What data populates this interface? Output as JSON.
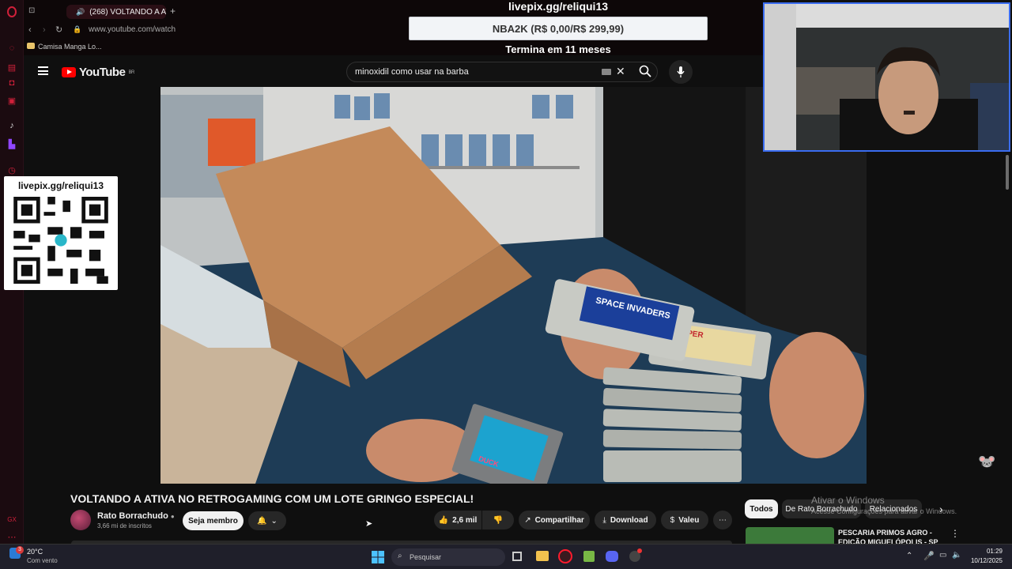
{
  "browser": {
    "tab_title": "(268) VOLTANDO A AT",
    "url": "www.youtube.com/watch",
    "bookmark": "Camisa Manga Lo...",
    "new_tab": "+"
  },
  "youtube": {
    "logo_text": "YouTube",
    "country": "BR",
    "search_value": "minoxidil como usar na barba"
  },
  "overlay": {
    "livepix_url": "livepix.gg/reliqui13",
    "goal": "NBA2K (R$ 0,00/R$ 299,99)",
    "ends_in": "Termina em 11 meses",
    "qr_url": "livepix.gg/reliqui13"
  },
  "video": {
    "title": "VOLTANDO A ATIVA NO RETROGAMING COM UM LOTE GRINGO ESPECIAL!",
    "channel": "Rato Borrachudo",
    "subscribers": "3,66 mi de inscritos",
    "join_label": "Seja membro",
    "likes": "2,6 mil",
    "share_label": "Compartilhar",
    "download_label": "Download",
    "thanks_label": "Valeu",
    "cartridge_1_text": "SPACE INVADERS",
    "cartridge_2_text": "SUPER",
    "cartridge_3_text": "DUCK"
  },
  "related": {
    "chips": [
      "Todos",
      "De Rato Borrachudo",
      "Relacionados"
    ],
    "first_video": "PESCARIA PRIMOS AGRO - EDIÇÃO MIGUELÓPOLIS - SP"
  },
  "windows": {
    "watermark_title": "Ativar o Windows",
    "watermark_sub": "Acesse Configurações para ativar o Windows.",
    "weather_temp": "20°C",
    "weather_desc": "Com vento",
    "weather_badge": "3",
    "search_placeholder": "Pesquisar",
    "time": "01:29",
    "date": "10/12/2025"
  },
  "colors": {
    "accent_red": "#ff0000",
    "opera_red": "#d0203a",
    "webcam_border": "#3a6cf0"
  }
}
